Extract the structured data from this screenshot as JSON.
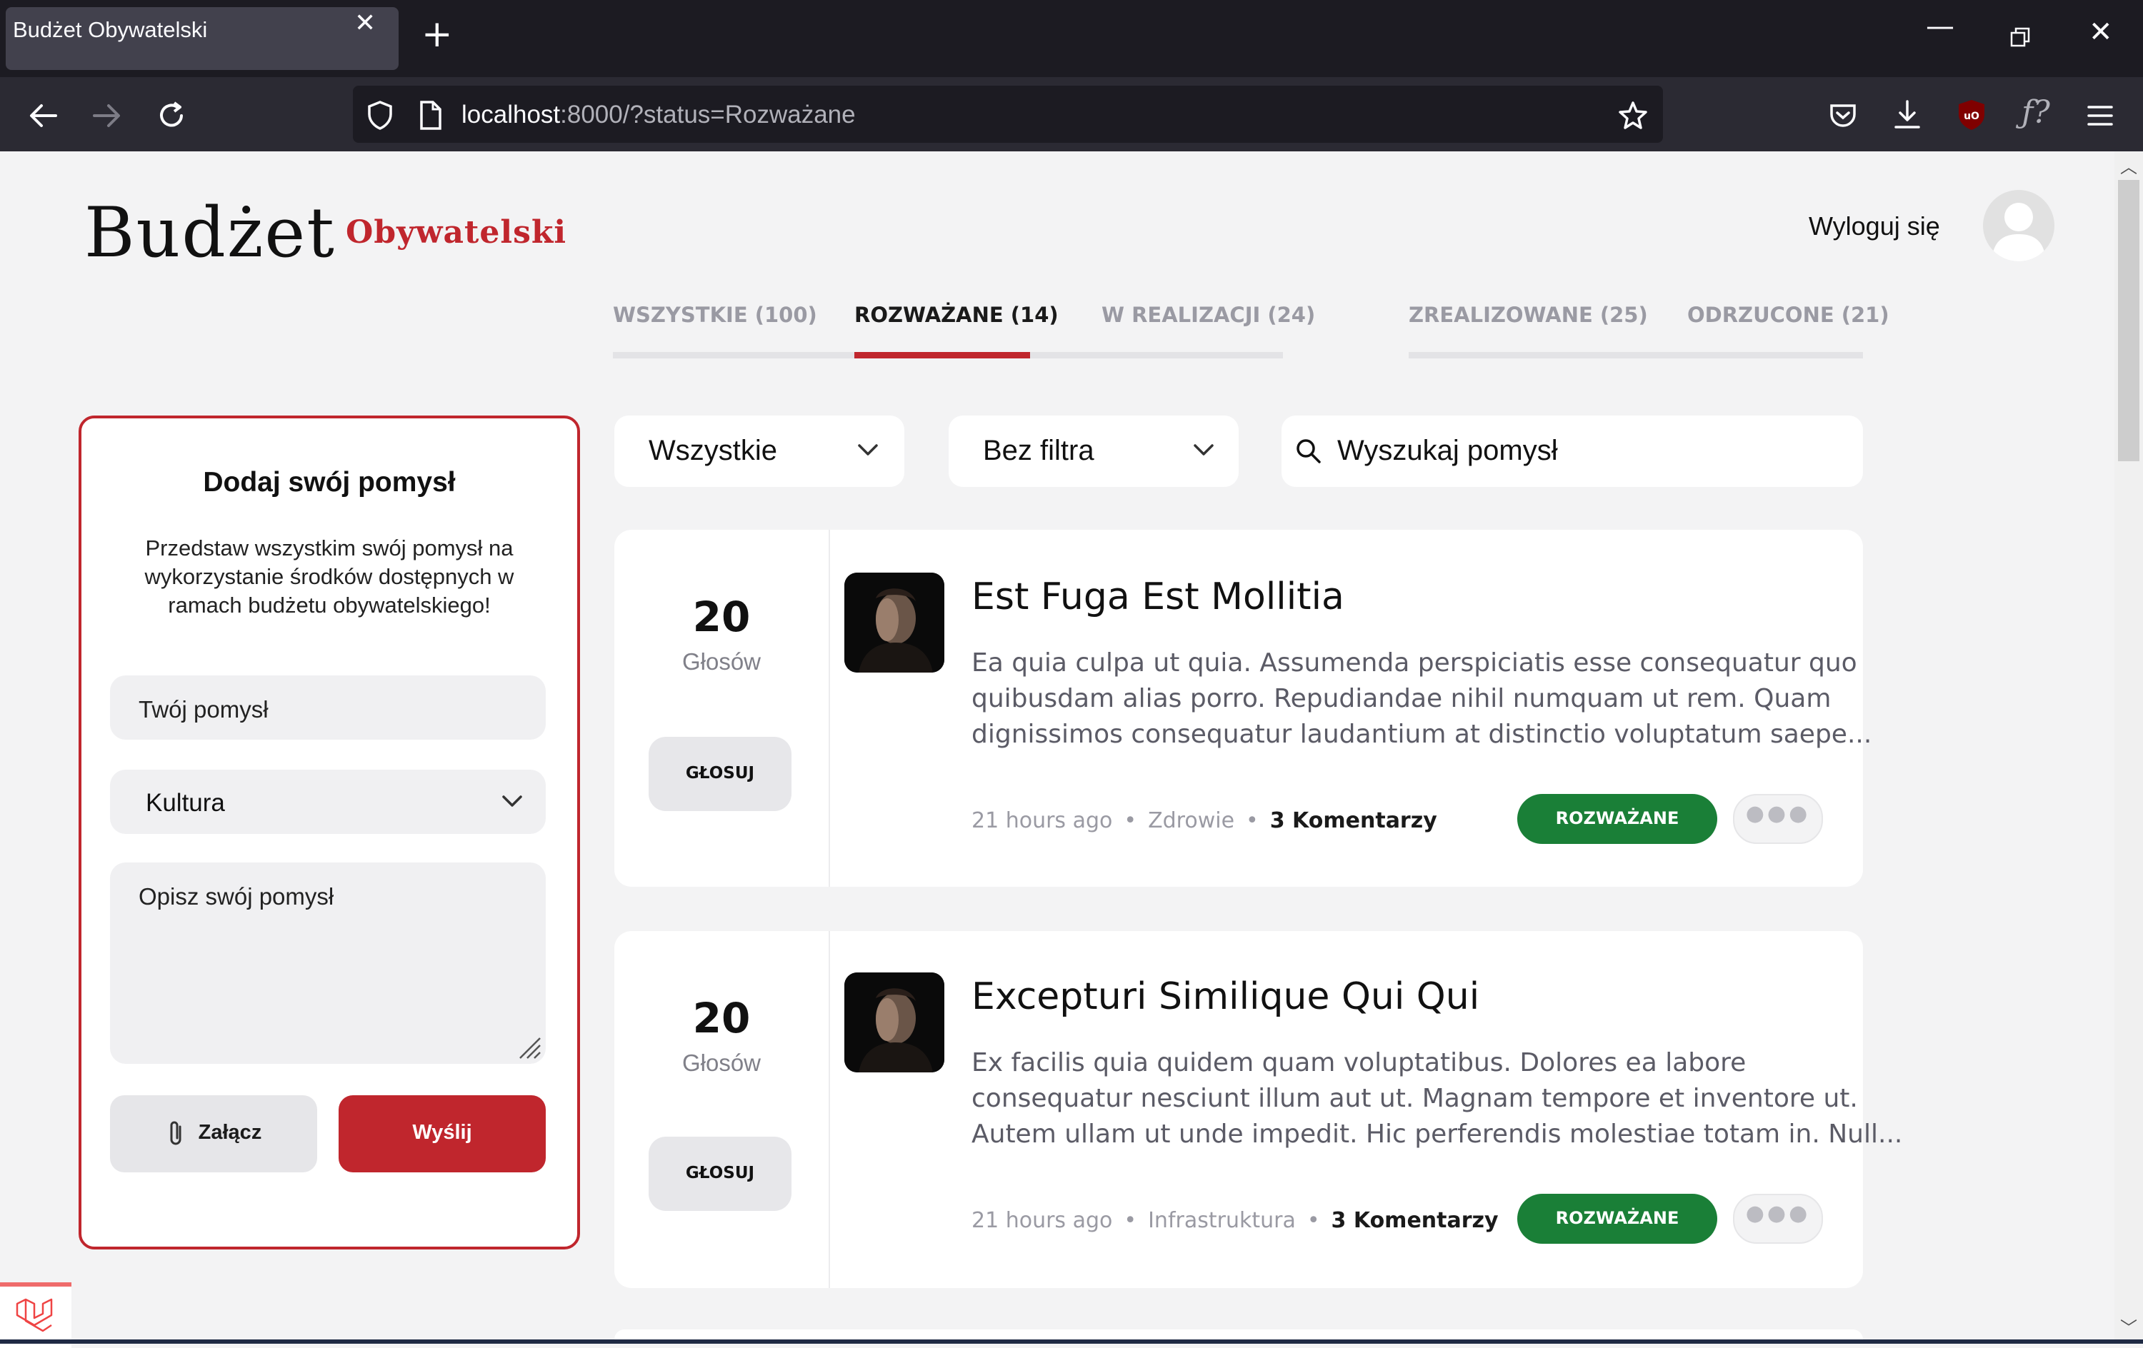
{
  "browser": {
    "tab_title": "Budżet Obywatelski",
    "url_host": "localhost",
    "url_path": ":8000/?status=Rozważane"
  },
  "header": {
    "logo_main": "Budżet",
    "logo_sub": "Obywatelski",
    "logout": "Wyloguj się"
  },
  "tabs": [
    {
      "label": "WSZYSTKIE (100)",
      "active": false
    },
    {
      "label": "ROZWAŻANE (14)",
      "active": true
    },
    {
      "label": "W REALIZACJI (24)",
      "active": false
    },
    {
      "label": "ZREALIZOWANE (25)",
      "active": false
    },
    {
      "label": "ODRZUCONE (21)",
      "active": false
    }
  ],
  "add_form": {
    "title": "Dodaj swój pomysł",
    "description_lines": [
      "Przedstaw wszystkim swój pomysł na",
      "wykorzystanie środków dostępnych w",
      "ramach budżetu obywatelskiego!"
    ],
    "idea_placeholder": "Twój pomysł",
    "category_value": "Kultura",
    "description_placeholder": "Opisz swój pomysł",
    "attach_label": "Załącz",
    "send_label": "Wyślij"
  },
  "filters": {
    "category": "Wszystkie",
    "filter": "Bez filtra",
    "search_placeholder": "Wyszukaj pomysł"
  },
  "ideas": [
    {
      "votes": "20",
      "votes_label": "Głosów",
      "vote_button": "GŁOSUJ",
      "title": "Est Fuga Est Mollitia",
      "description_lines": [
        "Ea quia culpa ut quia. Assumenda perspiciatis esse consequatur quo",
        "quibusdam alias porro. Repudiandae nihil numquam ut rem. Quam",
        "dignissimos consequatur laudantium at distinctio voluptatum saepe..."
      ],
      "time": "21 hours ago",
      "category": "Zdrowie",
      "comments": "3 Komentarzy",
      "status": "ROZWAŻANE"
    },
    {
      "votes": "20",
      "votes_label": "Głosów",
      "vote_button": "GŁOSUJ",
      "title": "Excepturi Similique Qui Qui",
      "description_lines": [
        "Ex facilis quia quidem quam voluptatibus. Dolores ea labore",
        "consequatur nesciunt illum aut ut. Magnam tempore et inventore ut.",
        "Autem ullam ut unde impedit. Hic perferendis molestiae totam in. Null..."
      ],
      "time": "21 hours ago",
      "category": "Infrastruktura",
      "comments": "3 Komentarzy",
      "status": "ROZWAŻANE"
    }
  ],
  "colors": {
    "brand_red": "#c0262d",
    "status_green": "#1a7f37",
    "page_bg": "#f3f3f4"
  },
  "icons": [
    "close-icon",
    "plus-icon",
    "back-arrow-icon",
    "forward-arrow-icon",
    "reload-icon",
    "shield-icon",
    "page-icon",
    "star-icon",
    "pocket-icon",
    "download-icon",
    "ublock-icon",
    "fx-icon",
    "menu-icon",
    "chevron-down-icon",
    "search-icon",
    "paperclip-icon",
    "resize-handle-icon",
    "laravel-icon"
  ]
}
